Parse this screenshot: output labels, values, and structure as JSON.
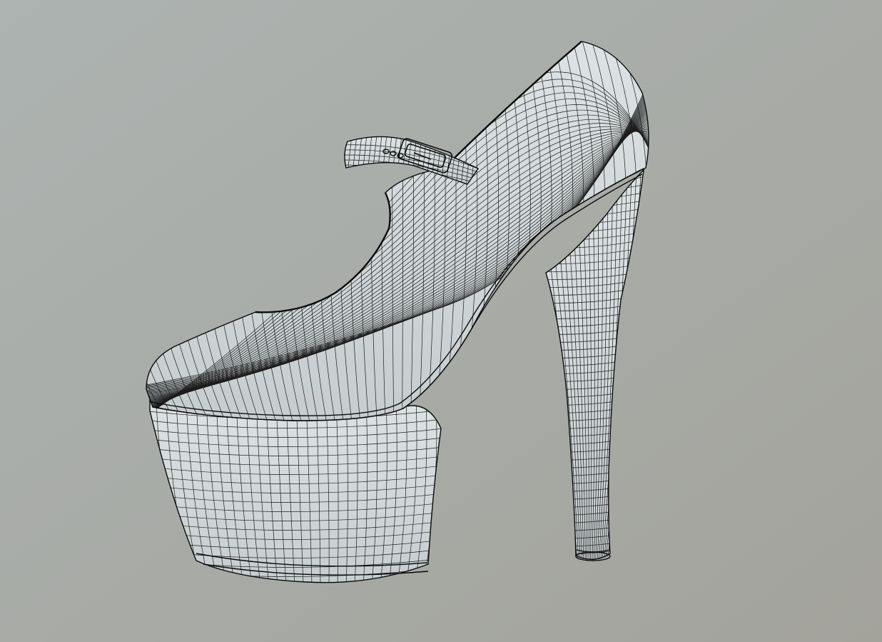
{
  "viewport": {
    "background_top": "#adb3b1",
    "background_bottom": "#a3a39c",
    "mesh_fill": "#dde3e4",
    "mesh_shade": "#c6cdcf",
    "wire_color": "#1c1c1c",
    "outline_color": "#0a0a0a"
  },
  "model": {
    "object_icon": "high-heel-shoe-icon",
    "strap_icon": "buckle-icon"
  }
}
